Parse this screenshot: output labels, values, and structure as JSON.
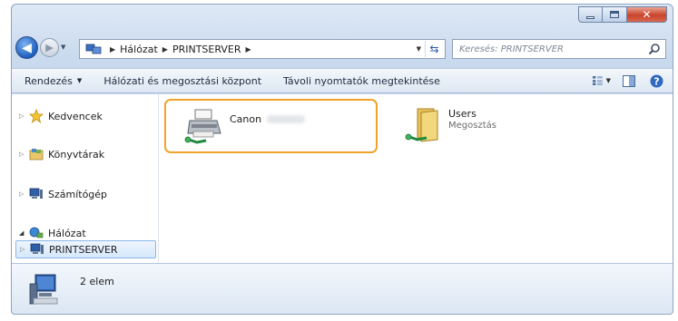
{
  "window": {
    "caption_buttons": {
      "minimize_icon": "minimize-icon",
      "maximize_icon": "maximize-icon",
      "close_icon": "close-icon"
    }
  },
  "navigation": {
    "back_icon": "back-arrow-icon",
    "forward_icon": "forward-arrow-icon",
    "breadcrumb": [
      "Hálózat",
      "PRINTSERVER"
    ],
    "search_placeholder": "Keresés: PRINTSERVER"
  },
  "toolbar": {
    "organize": "Rendezés",
    "network_center": "Hálózati és megosztási központ",
    "view_remote_printers": "Távoli nyomtatók megtekintése"
  },
  "sidebar": {
    "items": [
      {
        "label": "Kedvencek",
        "icon": "star-icon"
      },
      {
        "label": "Könyvtárak",
        "icon": "library-icon"
      },
      {
        "label": "Számítógép",
        "icon": "computer-icon"
      },
      {
        "label": "Hálózat",
        "icon": "network-icon"
      },
      {
        "label": "PRINTSERVER",
        "icon": "server-icon"
      }
    ]
  },
  "content": {
    "items": [
      {
        "name": "Canon",
        "icon": "shared-printer-icon"
      },
      {
        "name": "Users",
        "subtitle": "Megosztás",
        "icon": "shared-folder-icon"
      }
    ]
  },
  "status": {
    "text": "2 elem",
    "icon": "server-icon"
  },
  "colors": {
    "selection_border": "#f0a22a",
    "tree_selection": "#d6e8fc",
    "close_button": "#c9442c"
  }
}
